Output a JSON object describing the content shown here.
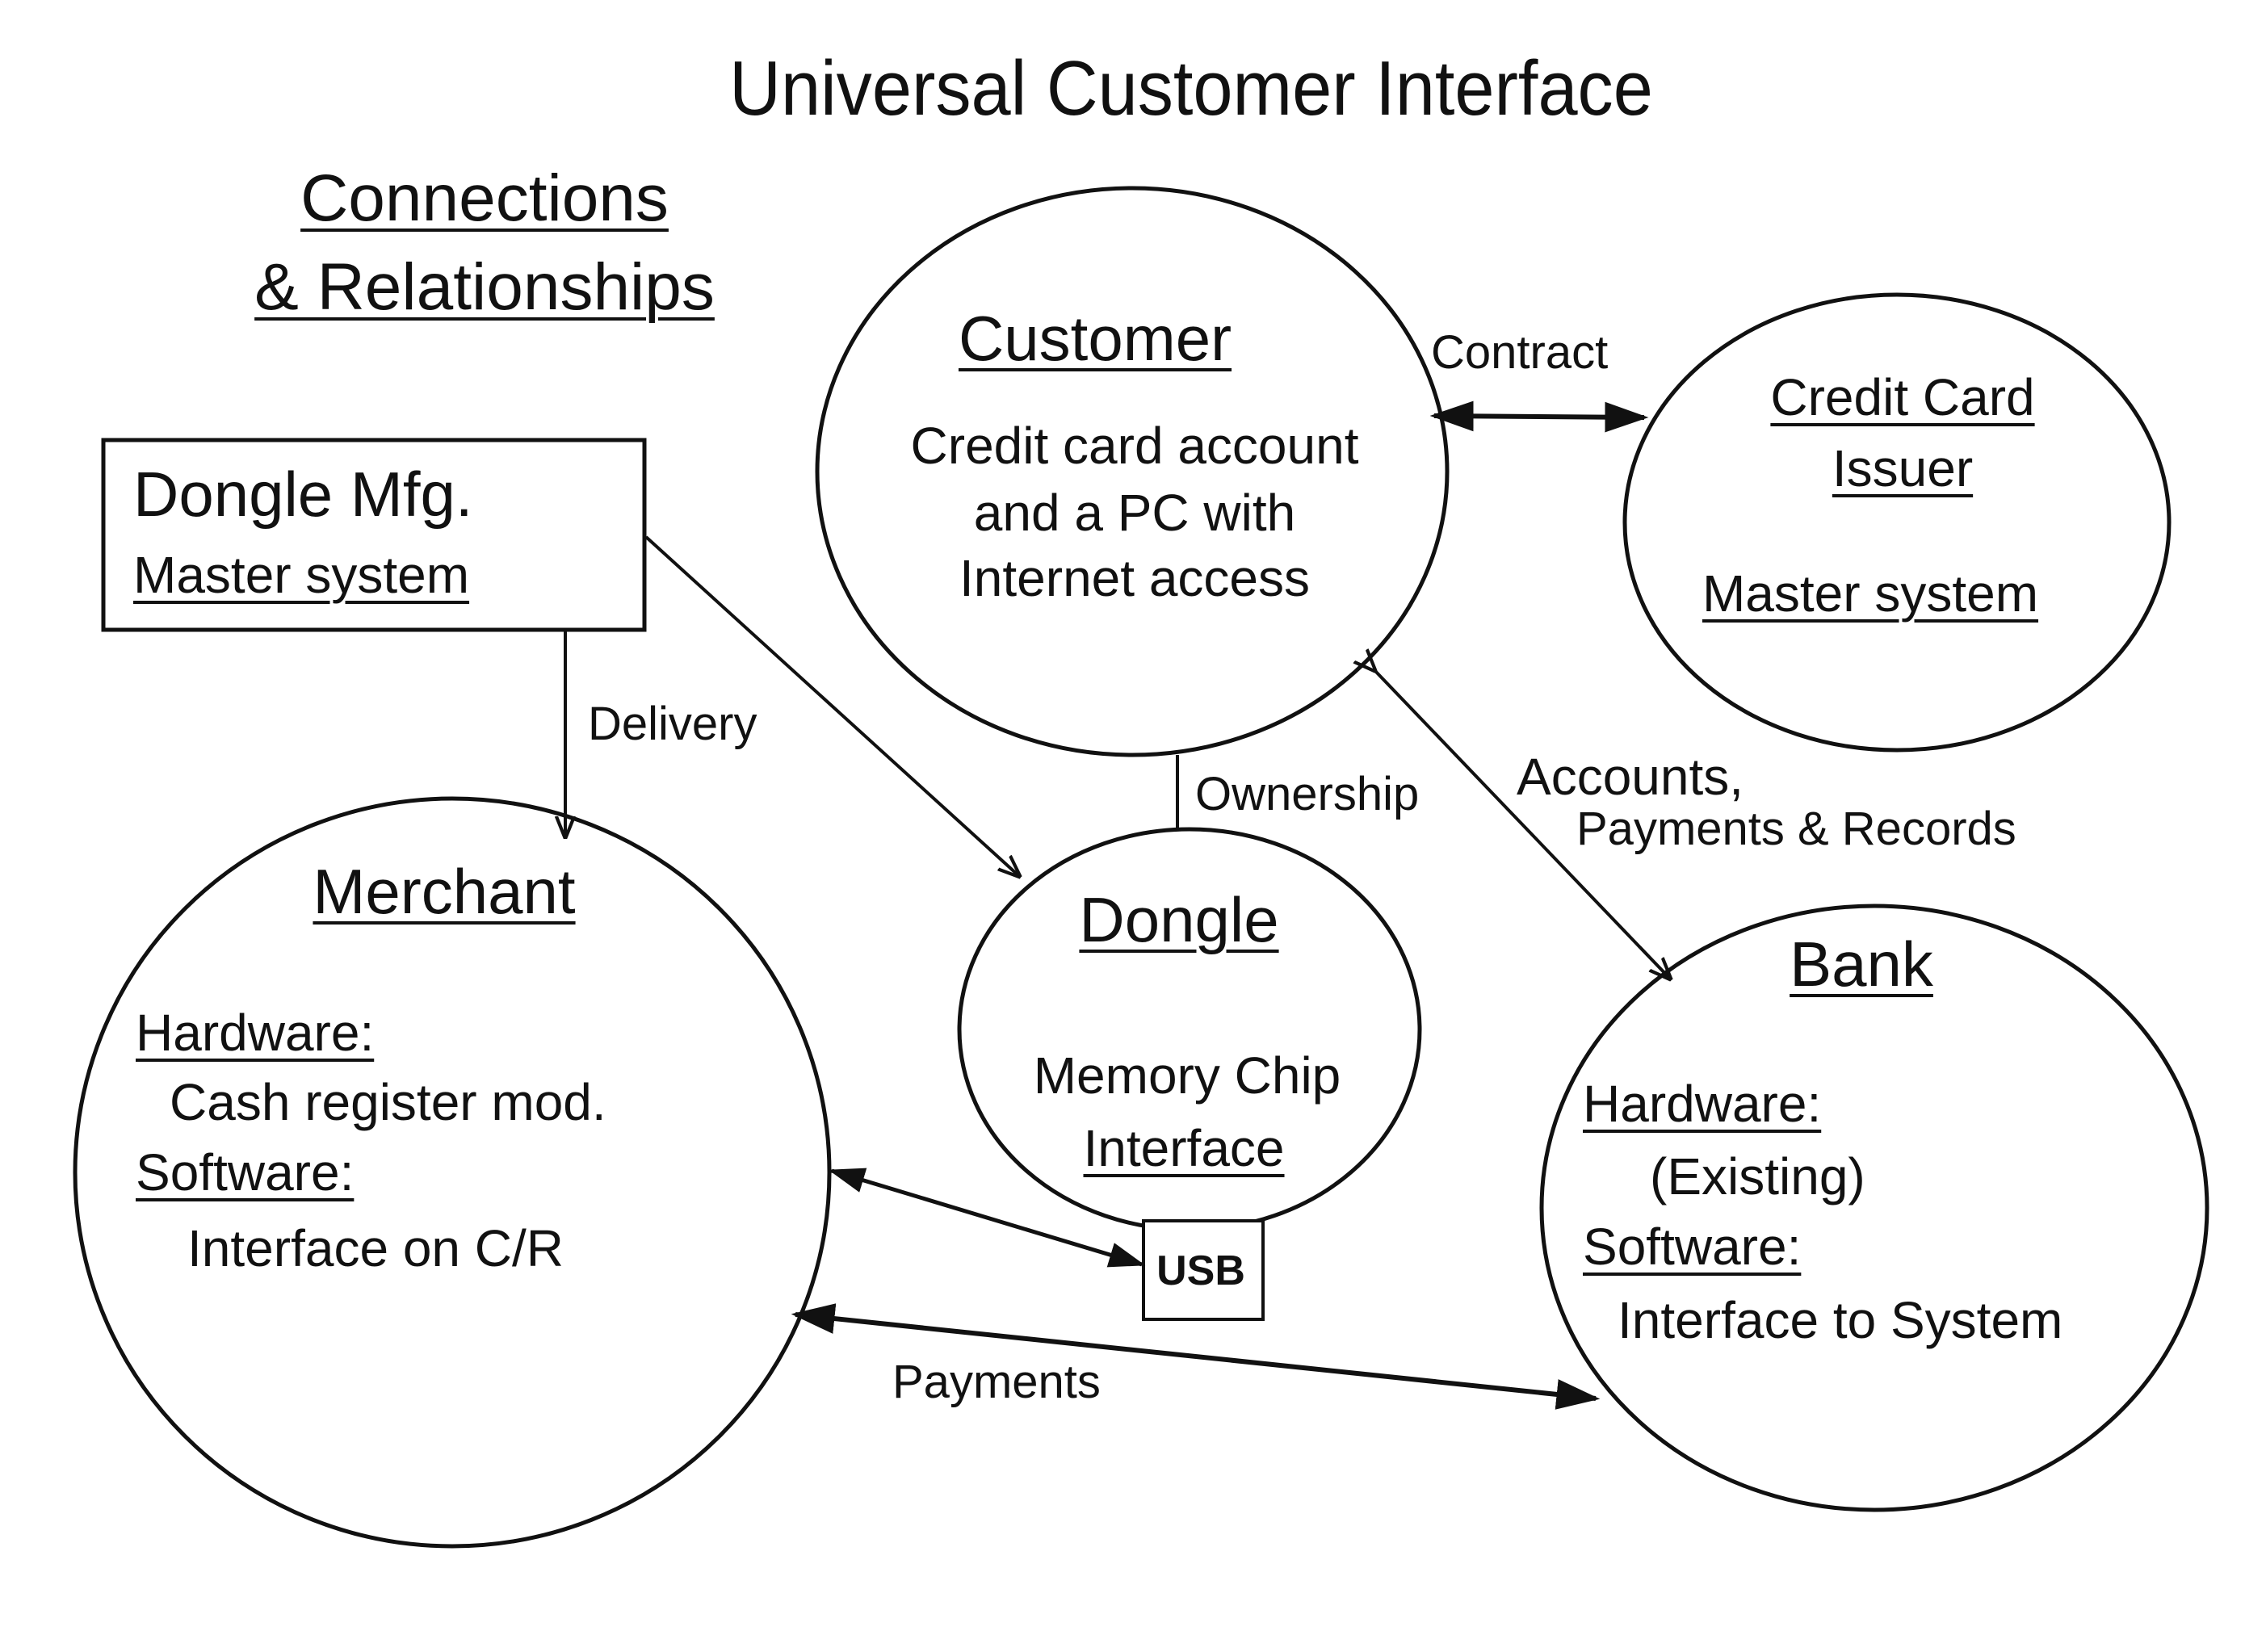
{
  "title": "Universal Customer Interface",
  "subtitle": {
    "line1": "Connections",
    "line2": "& Relationships"
  },
  "nodes": {
    "dongle_mfg": {
      "name": "Dongle Mfg.",
      "detail": "Master system"
    },
    "customer": {
      "name": "Customer",
      "lines": [
        "Credit card account",
        "and a PC with",
        "Internet access"
      ]
    },
    "credit_card_issuer": {
      "name_line1": "Credit Card",
      "name_line2": "Issuer",
      "detail": "Master system"
    },
    "merchant": {
      "name": "Merchant",
      "hardware_label": "Hardware:",
      "hardware_value": "Cash register mod.",
      "software_label": "Software:",
      "software_value": "Interface on C/R"
    },
    "dongle": {
      "name": "Dongle",
      "line1": "Memory Chip",
      "line2": "Interface",
      "port": "USB"
    },
    "bank": {
      "name": "Bank",
      "hardware_label": "Hardware:",
      "hardware_value": "(Existing)",
      "software_label": "Software:",
      "software_value": "Interface to System"
    }
  },
  "edges": {
    "contract": "Contract",
    "delivery": "Delivery",
    "ownership": "Ownership",
    "accounts_line1": "Accounts,",
    "accounts_line2": "Payments & Records",
    "payments": "Payments"
  },
  "colors": {
    "ink": "#111111",
    "paper": "#ffffff"
  }
}
